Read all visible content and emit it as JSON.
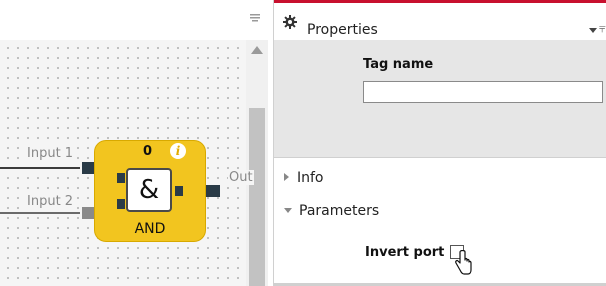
{
  "canvas": {
    "icons": {
      "funnel": "funnel-icon",
      "scroll_up": "arrow-up-icon"
    },
    "wires": [
      {
        "label": "Input 1"
      },
      {
        "label": "Input 2"
      }
    ],
    "output_label": "Out",
    "block": {
      "counter": "0",
      "info_glyph": "i",
      "symbol": "&",
      "name": "AND",
      "color": "#f2c51f"
    }
  },
  "properties": {
    "title": "Properties",
    "accent_color": "#c8102e",
    "icons": {
      "title": "gear-icon",
      "menu": "dropdown-arrow-icon",
      "pin": "pin-icon"
    },
    "tag_name": {
      "label": "Tag name",
      "value": ""
    },
    "sections": [
      {
        "label": "Info",
        "expanded": false
      },
      {
        "label": "Parameters",
        "expanded": true
      }
    ],
    "invert_port": {
      "label": "Invert port",
      "checked": false
    }
  }
}
